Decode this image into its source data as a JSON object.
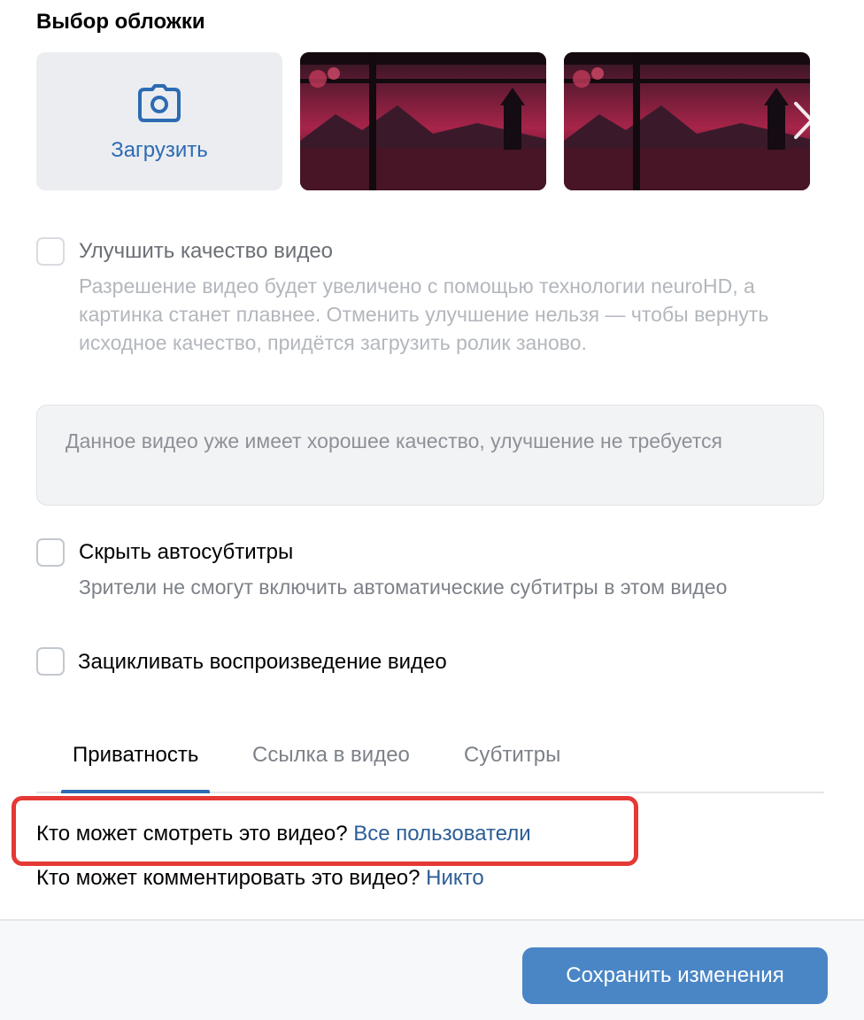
{
  "cover": {
    "title": "Выбор обложки",
    "upload_label": "Загрузить",
    "upload_icon": "camera-icon",
    "next_icon": "chevron-right-icon"
  },
  "options": {
    "enhance": {
      "label": "Улучшить качество видео",
      "description": "Разрешение видео будет увеличено с помощью технологии neuroHD, а картинка станет плавнее. Отменить улучшение нельзя — чтобы вернуть исходное качество, придётся загрузить ролик заново.",
      "checked": false,
      "disabled": true
    },
    "enhance_info": "Данное видео уже имеет хорошее качество, улучшение не требуется",
    "hide_autosubs": {
      "label": "Скрыть автосубтитры",
      "description": "Зрители не смогут включить автоматические субтитры в этом видео",
      "checked": false
    },
    "loop": {
      "label": "Зацикливать воспроизведение видео",
      "checked": false
    }
  },
  "tabs": [
    {
      "label": "Приватность",
      "active": true
    },
    {
      "label": "Ссылка в видео",
      "active": false
    },
    {
      "label": "Субтитры",
      "active": false
    }
  ],
  "privacy": {
    "view_question": "Кто может смотреть это видео?",
    "view_value": "Все пользователи",
    "comment_question": "Кто может комментировать это видео?",
    "comment_value": "Никто"
  },
  "footer": {
    "save_label": "Сохранить изменения"
  },
  "colors": {
    "accent": "#2d6bb3",
    "link": "#2d5e96",
    "button": "#4a86c5",
    "highlight": "#e53935"
  }
}
